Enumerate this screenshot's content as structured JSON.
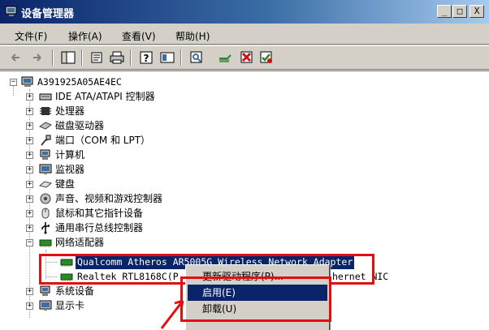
{
  "window": {
    "title": "设备管理器",
    "controls": {
      "minimize": "_",
      "maximize": "□",
      "close": "X"
    }
  },
  "menu": {
    "file": "文件(F)",
    "action": "操作(A)",
    "view": "查看(V)",
    "help": "帮助(H)"
  },
  "toolbar": {
    "icons": [
      "back-arrow-icon",
      "forward-arrow-icon",
      "show-hide-tree-icon",
      "properties-icon",
      "print-icon",
      "help-icon",
      "view-icon",
      "scan-hardware-icon",
      "update-driver-icon",
      "uninstall-icon",
      "disable-icon"
    ]
  },
  "tree": {
    "root": "A391925A05AE4EC",
    "items": [
      "IDE ATA/ATAPI 控制器",
      "处理器",
      "磁盘驱动器",
      "端口（COM 和 LPT）",
      "计算机",
      "监视器",
      "键盘",
      "声音、视频和游戏控制器",
      "鼠标和其它指针设备",
      "通用串行总线控制器",
      "网络适配器"
    ],
    "network_children": [
      "Qualcomm Atheros AR5005G Wireless Network Adapter",
      "Realtek RTL8168C(P"
    ],
    "realtek_suffix": "hernet NIC",
    "after_items": [
      "系统设备",
      "显示卡"
    ]
  },
  "context_menu": {
    "items": [
      "更新驱动程序(P)...",
      "启用(E)",
      "卸载(U)",
      ""
    ],
    "highlighted_index": 1
  },
  "colors": {
    "selection": "#0a246a",
    "annotation_red": "#e01010",
    "title_gradient_start": "#0a246a"
  }
}
